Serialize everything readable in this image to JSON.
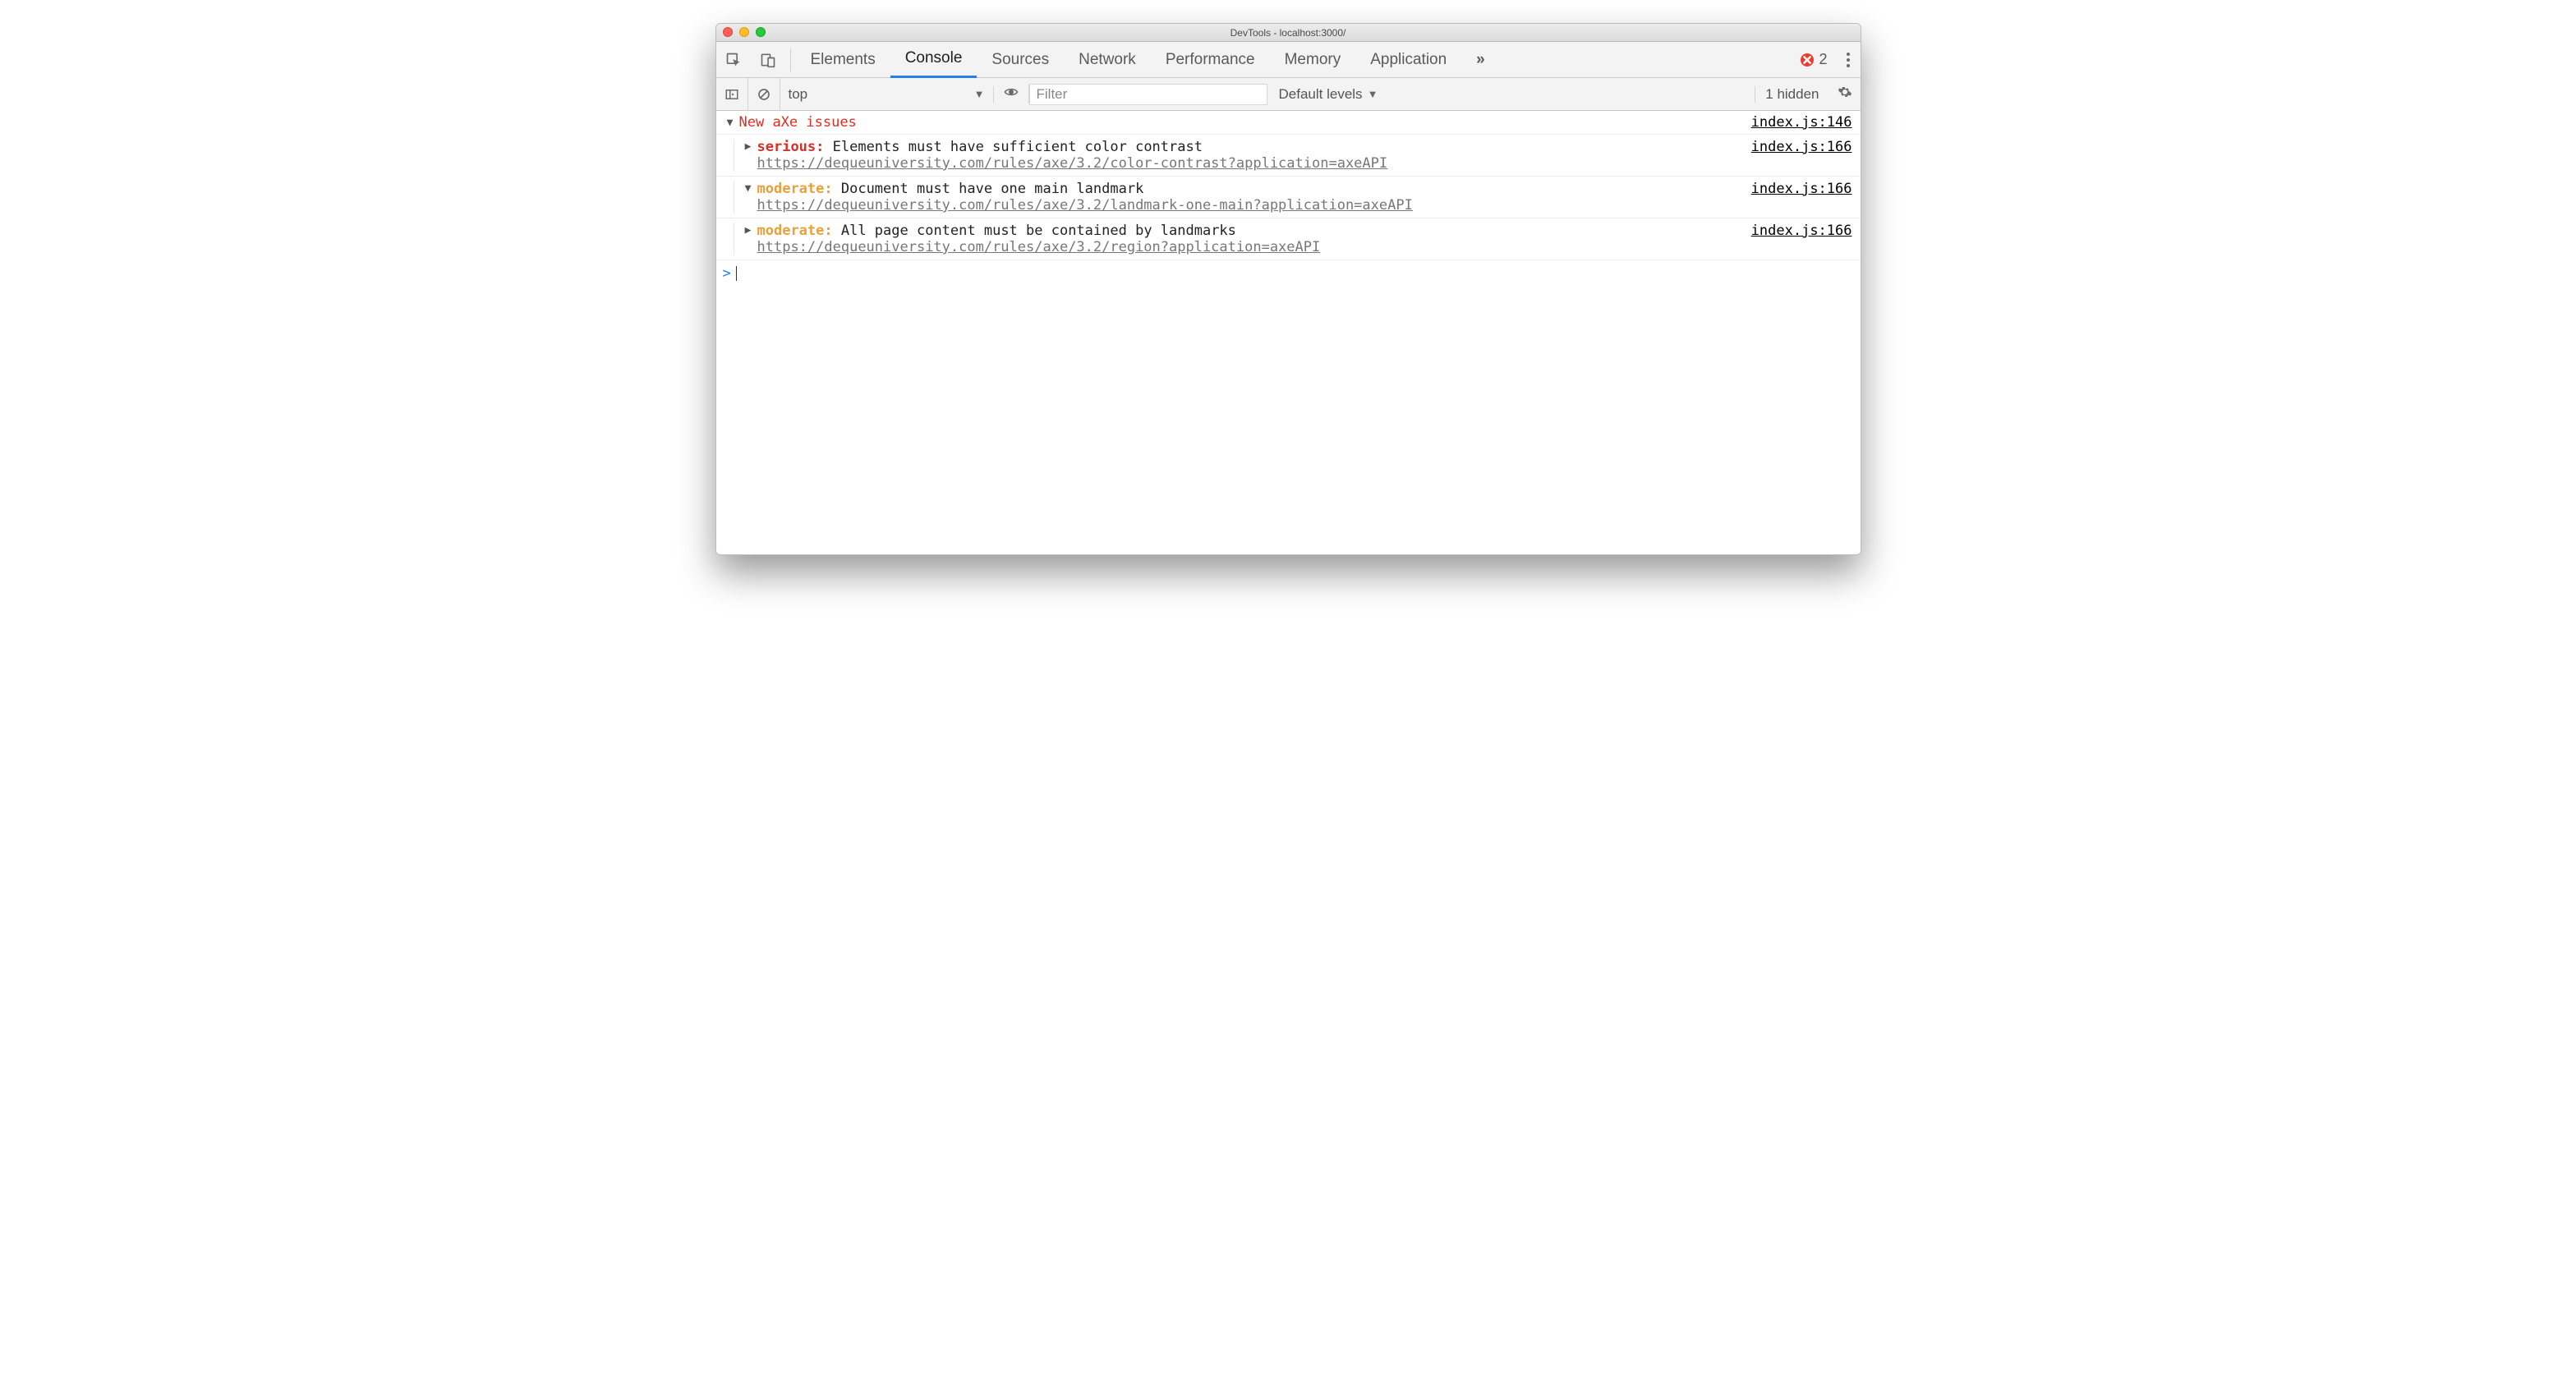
{
  "window": {
    "title": "DevTools - localhost:3000/"
  },
  "tabs": {
    "items": [
      {
        "label": "Elements",
        "active": false
      },
      {
        "label": "Console",
        "active": true
      },
      {
        "label": "Sources",
        "active": false
      },
      {
        "label": "Network",
        "active": false
      },
      {
        "label": "Performance",
        "active": false
      },
      {
        "label": "Memory",
        "active": false
      },
      {
        "label": "Application",
        "active": false
      }
    ],
    "overflow_glyph": "»",
    "error_count": "2"
  },
  "console_bar": {
    "context": "top",
    "filter_placeholder": "Filter",
    "levels": "Default levels",
    "hidden": "1 hidden"
  },
  "console": {
    "group_title": "New aXe issues",
    "group_src": "index.js:146",
    "messages": [
      {
        "expanded": false,
        "severity": "serious",
        "severity_label": "serious:",
        "text": "Elements must have sufficient color contrast",
        "url": "https://dequeuniversity.com/rules/axe/3.2/color-contrast?application=axeAPI",
        "src": "index.js:166"
      },
      {
        "expanded": true,
        "severity": "moderate",
        "severity_label": "moderate:",
        "text": "Document must have one main landmark",
        "url": "https://dequeuniversity.com/rules/axe/3.2/landmark-one-main?application=axeAPI",
        "src": "index.js:166"
      },
      {
        "expanded": false,
        "severity": "moderate",
        "severity_label": "moderate:",
        "text": "All page content must be contained by landmarks",
        "url": "https://dequeuniversity.com/rules/axe/3.2/region?application=axeAPI",
        "src": "index.js:166"
      }
    ],
    "prompt": ">"
  }
}
